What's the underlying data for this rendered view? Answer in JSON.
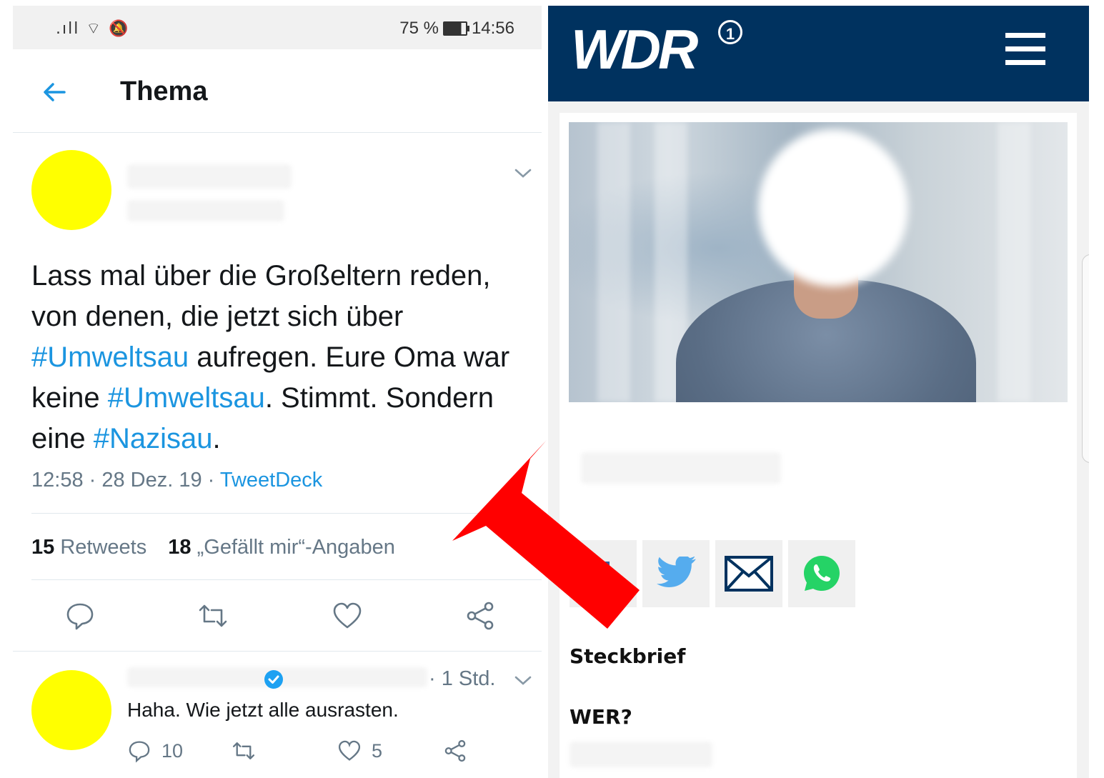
{
  "twitter": {
    "status_bar": {
      "signal_icons": ".ıll ⌔ 🔕",
      "battery": "75 %",
      "time": "14:56"
    },
    "header": {
      "title": "Thema"
    },
    "tweet": {
      "text_parts": [
        "Lass mal über die Großeltern reden, von denen, die jetzt sich über ",
        "#Umweltsau",
        " aufregen. Eure Oma war keine ",
        "#Umweltsau",
        ". Stimmt. Sondern eine ",
        "#Nazisau",
        "."
      ],
      "meta_time": "12:58 · 28 Dez. 19 · ",
      "meta_source": "TweetDeck",
      "retweets_count": "15",
      "retweets_label": "Retweets",
      "likes_count": "18",
      "likes_label": "„Gefällt mir“-Angaben"
    },
    "reply": {
      "time": "· 1 Std.",
      "text": "Haha. Wie jetzt alle ausrasten.",
      "reply_count": "10",
      "like_count": "5"
    },
    "colors": {
      "link": "#1b95e0",
      "avatar": "#ffff00"
    }
  },
  "wdr": {
    "logo": "WDR",
    "logo_badge": "1",
    "sections": {
      "profile": "Steckbrief",
      "who": "WER?"
    },
    "colors": {
      "bar": "#00325f"
    },
    "share_icons": [
      "facebook-icon",
      "twitter-icon",
      "mail-icon",
      "whatsapp-icon"
    ]
  },
  "overlay": {
    "arrow_color": "#ff0000"
  }
}
